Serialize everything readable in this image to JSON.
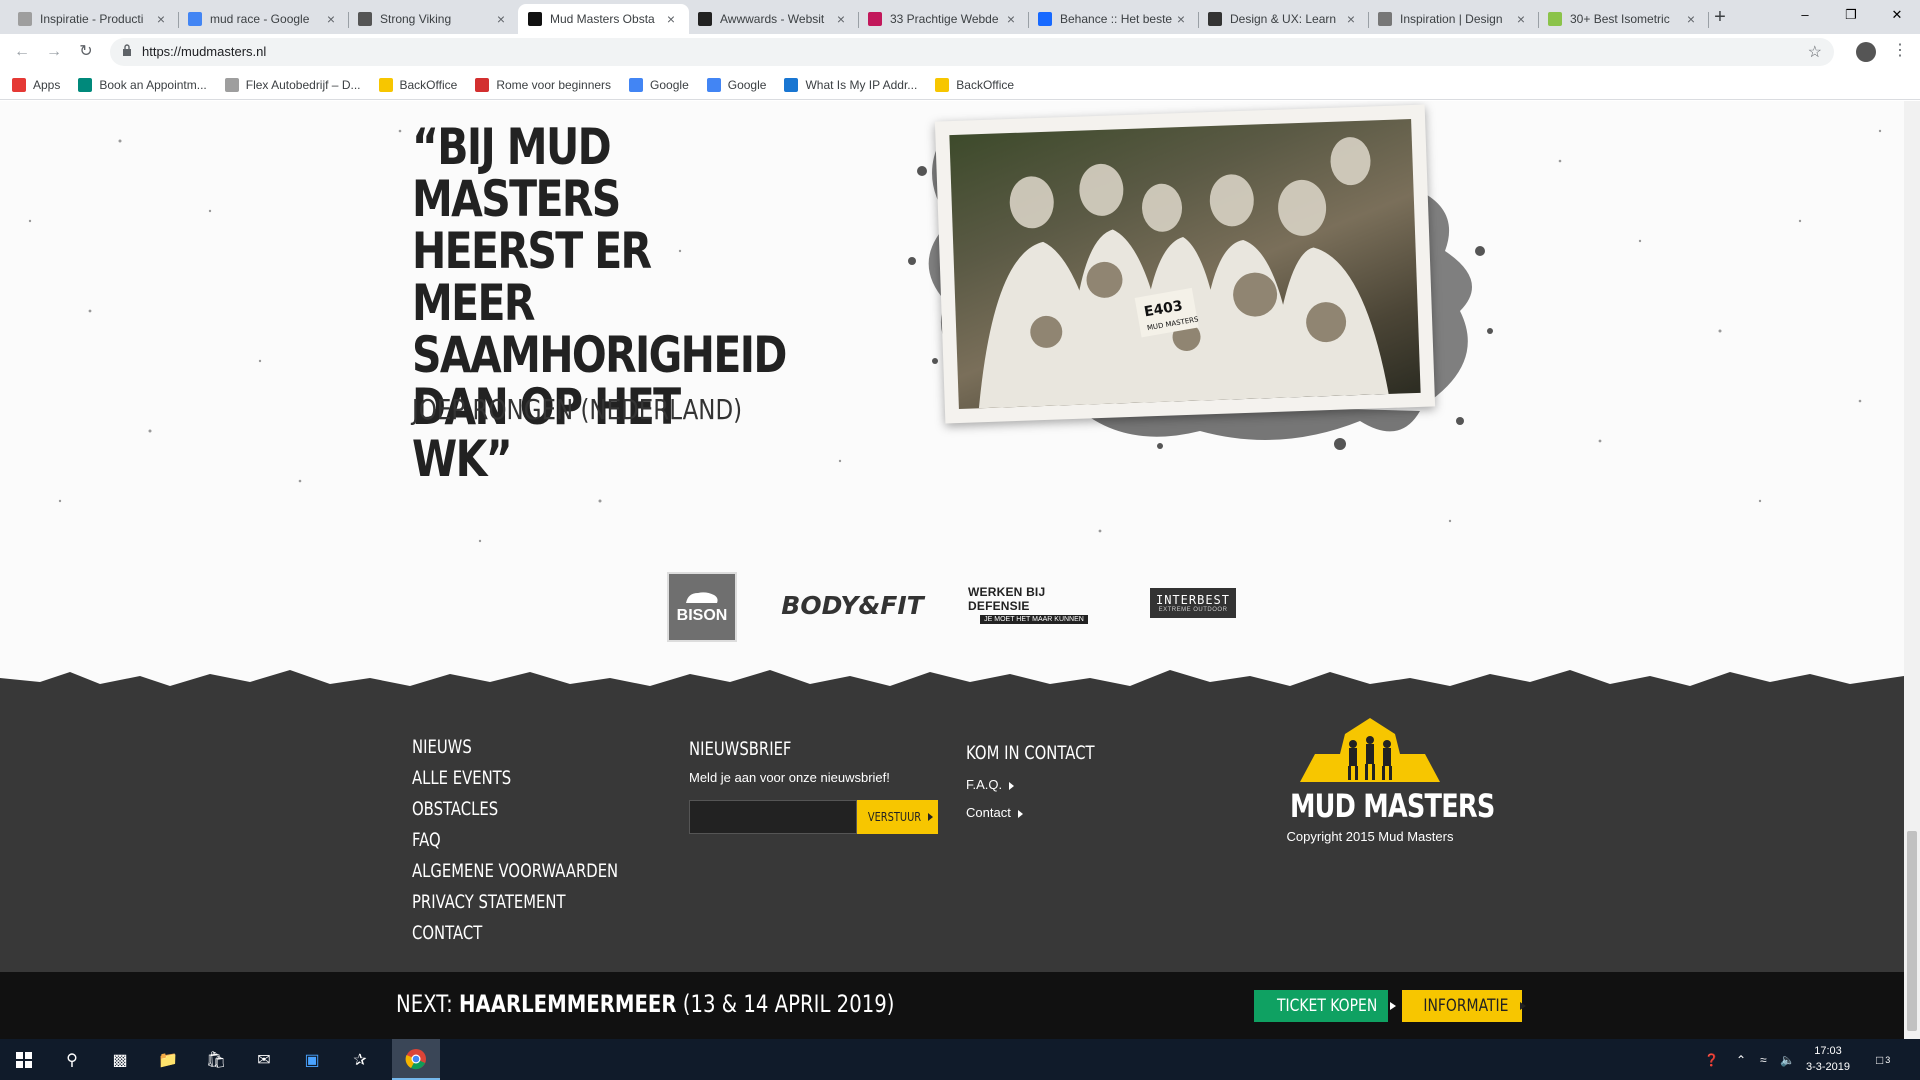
{
  "browser": {
    "tabs": [
      {
        "title": "Inspiratie - Producti",
        "color": "#9e9e9e"
      },
      {
        "title": "mud race - Google",
        "color": "#4285f4"
      },
      {
        "title": "Strong Viking",
        "color": "#555555"
      },
      {
        "title": "Mud Masters Obsta",
        "color": "#111111"
      },
      {
        "title": "Awwwards - Websit",
        "color": "#222222"
      },
      {
        "title": "33 Prachtige Webde",
        "color": "#c2185b"
      },
      {
        "title": "Behance :: Het beste",
        "color": "#1769ff"
      },
      {
        "title": "Design & UX: Learn",
        "color": "#333333"
      },
      {
        "title": "Inspiration | Design",
        "color": "#777777"
      },
      {
        "title": "30+ Best Isometric",
        "color": "#8bc34a"
      }
    ],
    "new_tab_label": "+",
    "url": "https://mudmasters.nl",
    "bookmarks": [
      {
        "label": "Apps",
        "color": "#e53935"
      },
      {
        "label": "Book an Appointm...",
        "color": "#00897b"
      },
      {
        "label": "Flex Autobedrijf – D...",
        "color": "#9e9e9e"
      },
      {
        "label": "BackOffice",
        "color": "#f7c600"
      },
      {
        "label": "Rome voor beginners",
        "color": "#d32f2f"
      },
      {
        "label": "Google",
        "color": "#4285f4"
      },
      {
        "label": "Google",
        "color": "#4285f4"
      },
      {
        "label": "What Is My IP Addr...",
        "color": "#1976d2"
      },
      {
        "label": "BackOffice",
        "color": "#f7c600"
      }
    ]
  },
  "testimonial": {
    "quote": "“BIJ MUD MASTERS HEERST ER MEER SAAMHORIGHEID DAN OP HET WK”",
    "author": "JOEP RONGEN (NEDERLAND)",
    "bib_number": "E403",
    "bib_brand": "MUD MASTERS"
  },
  "sponsors": {
    "bison": "BISON",
    "bodyfit": "BODY&FIT",
    "defensie_line1": "WERKEN BIJ DEFENSIE",
    "defensie_line2": "JE MOET HET MAAR KUNNEN",
    "interbest_line1": "INTERBEST",
    "interbest_line2": "EXTREME OUTDOOR"
  },
  "footer": {
    "nav": [
      "NIEUWS",
      "ALLE EVENTS",
      "OBSTACLES",
      "FAQ",
      "ALGEMENE VOORWAARDEN",
      "PRIVACY STATEMENT",
      "CONTACT"
    ],
    "newsletter_title": "NIEUWSBRIEF",
    "newsletter_text": "Meld je aan voor onze nieuwsbrief!",
    "newsletter_input_value": "",
    "newsletter_button": "VERSTUUR",
    "contact_title": "KOM IN CONTACT",
    "contact_links": [
      "F.A.Q.",
      "Contact"
    ],
    "logo_text": "MUD MASTERS",
    "copyright": "Copyright 2015 Mud Masters",
    "brand_yellow": "#f7c600"
  },
  "next_event": {
    "prefix": "NEXT:",
    "location": "HAARLEMMERMEER",
    "dates": "(13 & 14 APRIL 2019)",
    "ticket_button": "TICKET KOPEN",
    "info_button": "INFORMATIE",
    "ticket_color": "#0fa162",
    "info_color": "#f7c600"
  },
  "taskbar": {
    "time": "17:03",
    "date": "3-3-2019",
    "notification_count": "3"
  }
}
